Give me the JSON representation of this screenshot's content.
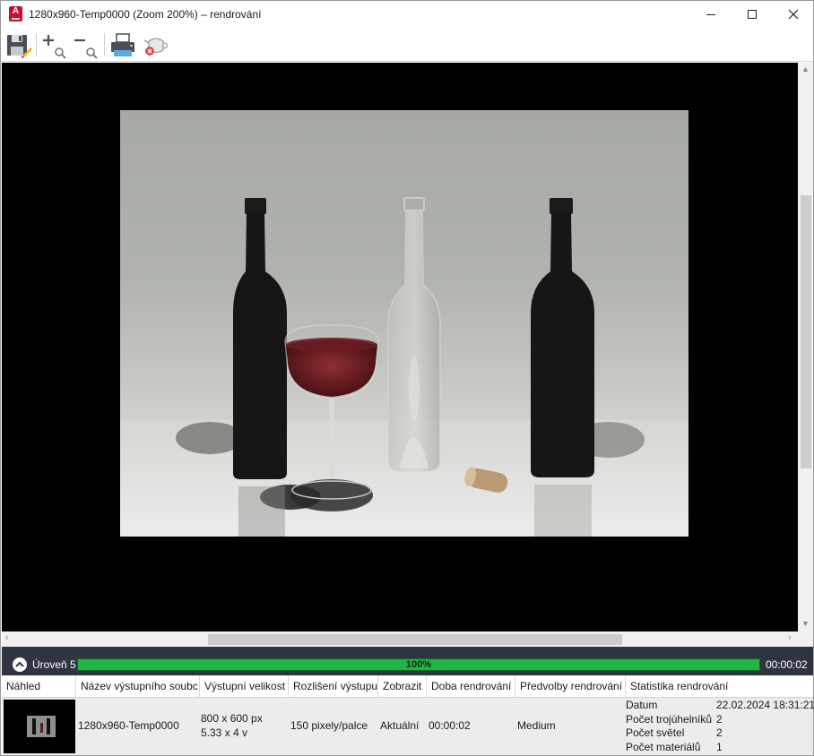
{
  "window": {
    "title": "1280x960-Temp0000 (Zoom 200%) – rendrování",
    "app_icon": "autocad-icon",
    "controls": [
      "minimize-icon",
      "maximize-icon",
      "close-icon"
    ]
  },
  "toolbar": {
    "items": [
      {
        "name": "save-icon",
        "tooltip": ""
      },
      {
        "name": "zoom-in-icon",
        "tooltip": ""
      },
      {
        "name": "zoom-out-icon",
        "tooltip": ""
      },
      {
        "name": "print-icon",
        "tooltip": ""
      },
      {
        "name": "cancel-render-icon",
        "tooltip": ""
      }
    ]
  },
  "viewport": {
    "image": "rendered-scene-wine-bottles-glass-cork"
  },
  "progress": {
    "level_label": "Úroveň 5",
    "percent_text": "100%",
    "percent_value": 1.0,
    "elapsed": "00:00:02",
    "colors": {
      "bar": "#22b545",
      "strip": "#2e3440"
    }
  },
  "history": {
    "columns": [
      "Náhled",
      "Název výstupního soubc",
      "Výstupní velikost",
      "Rozlišení výstupu",
      "Zobrazit",
      "Doba rendrování",
      "Předvolby rendrování",
      "Statistika rendrování"
    ],
    "row": {
      "filename": "1280x960-Temp0000",
      "size_px": "800 x 600 px",
      "size_in": "5.33 x 4 v",
      "resolution": "150 pixely/palce",
      "view": "Aktuální",
      "render_time": "00:00:02",
      "preset": "Medium",
      "stats": [
        {
          "label": "Datum",
          "value": "22.02.2024 18:31:21"
        },
        {
          "label": "Počet trojúhelníků",
          "value": "2"
        },
        {
          "label": "Počet světel",
          "value": "2"
        },
        {
          "label": "Počet materiálů",
          "value": "1"
        }
      ]
    }
  }
}
